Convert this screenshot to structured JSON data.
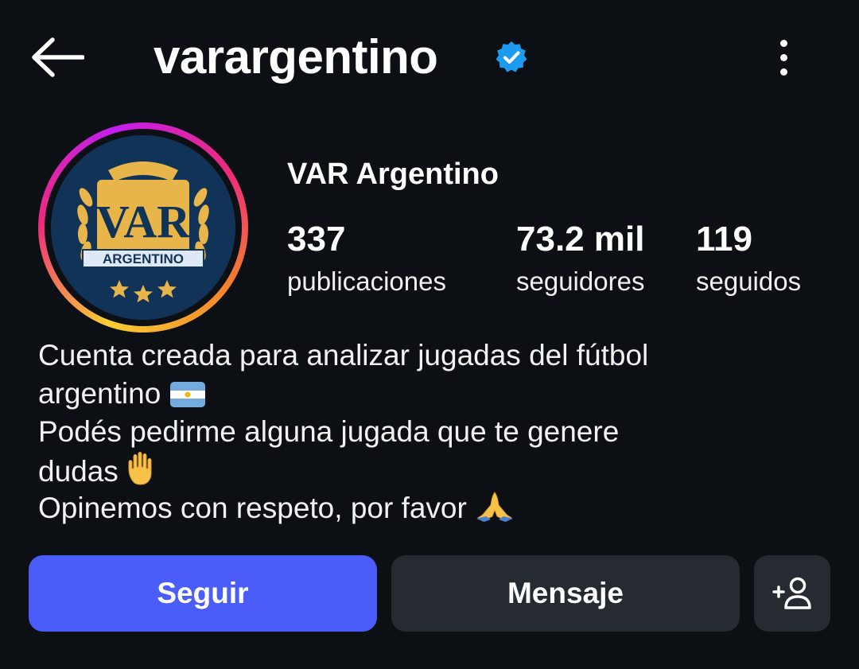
{
  "header": {
    "username": "varargentino",
    "back_icon": "arrow-left-icon",
    "verified_icon": "verified-badge-icon",
    "more_icon": "more-vertical-icon"
  },
  "profile": {
    "display_name": "VAR Argentino",
    "avatar": {
      "logo_text": "VAR",
      "logo_banner": "ARGENTINO"
    },
    "stats": {
      "posts": {
        "value": "337",
        "label": "publicaciones"
      },
      "followers": {
        "value": "73.2 mil",
        "label": "seguidores"
      },
      "following": {
        "value": "119",
        "label": "seguidos"
      }
    }
  },
  "bio": {
    "line1": "Cuenta creada para analizar jugadas del fútbol",
    "line2": "argentino",
    "line3": "Podés pedirme alguna jugada que te genere",
    "line4": "dudas",
    "line5": "Opinemos con respeto, por favor",
    "emojis": [
      "argentina-flag-icon",
      "raised-hand-icon",
      "folded-hands-icon"
    ]
  },
  "actions": {
    "follow_label": "Seguir",
    "message_label": "Mensaje",
    "add_user_icon": "add-user-icon"
  },
  "colors": {
    "background": "#0c0f14",
    "follow_button": "#4a5df9",
    "secondary_button": "#262a31",
    "verified": "#1d9bf0",
    "logo_gold": "#e8b54a",
    "logo_navy": "#103357"
  }
}
